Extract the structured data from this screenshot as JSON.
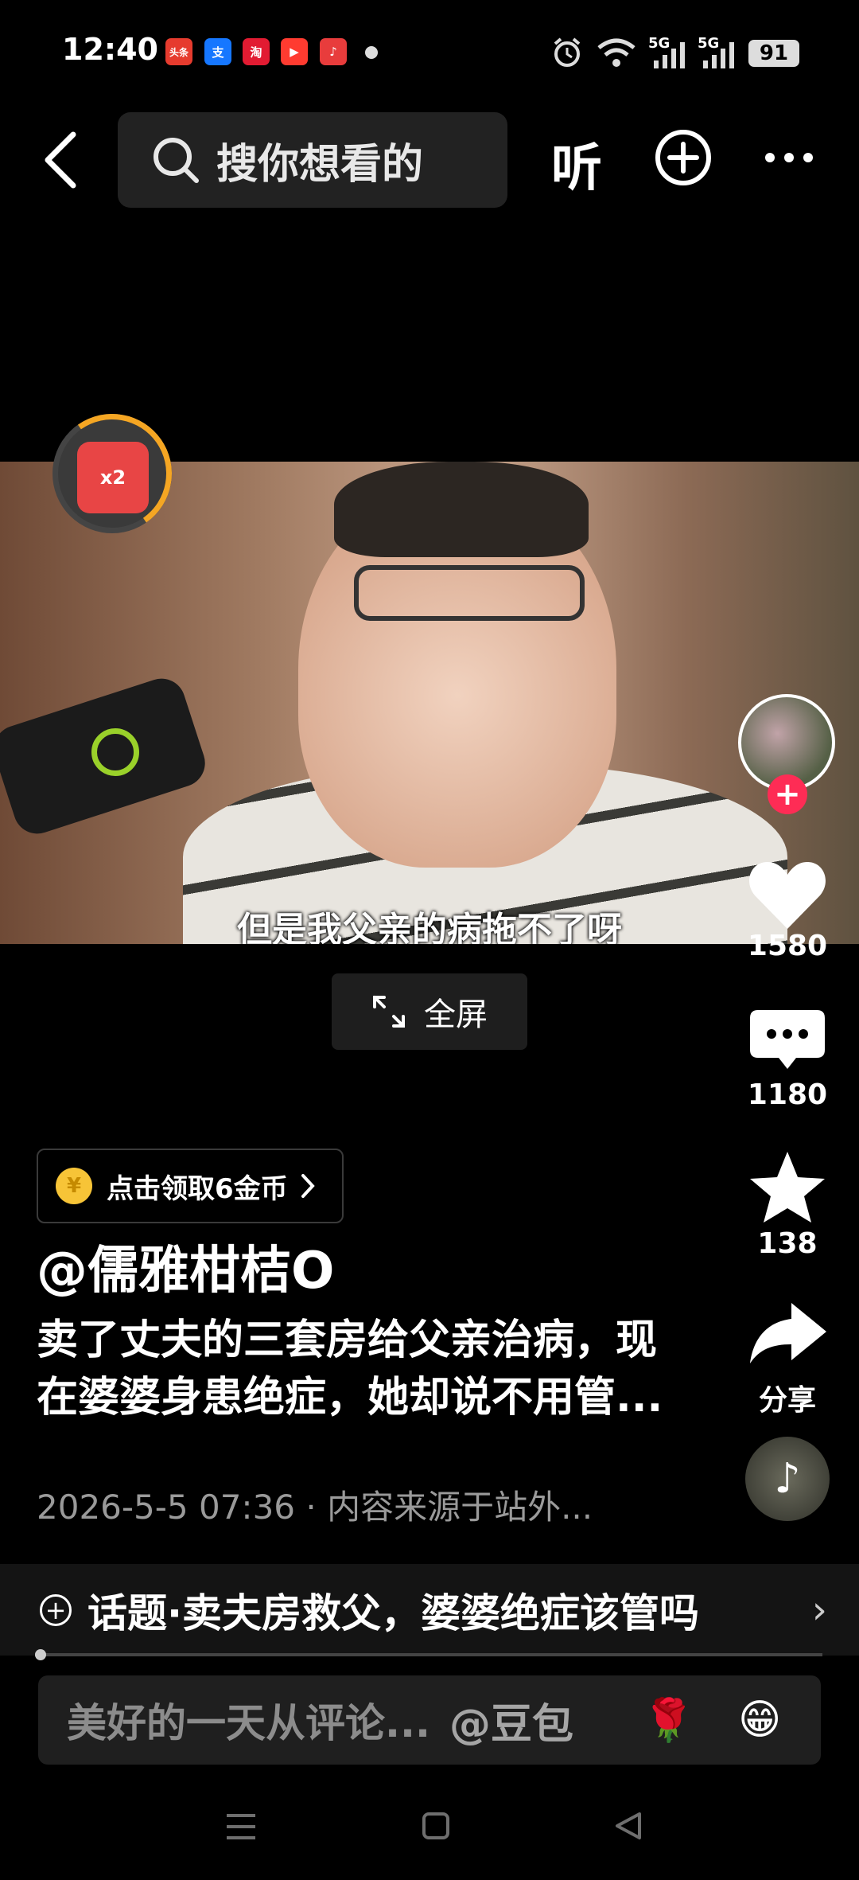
{
  "status_bar": {
    "time": "12:40",
    "app_icons": [
      {
        "name": "toutiao-icon",
        "label": "头条",
        "color": "#e63b2e"
      },
      {
        "name": "alipay-icon",
        "label": "支",
        "color": "#1677ff"
      },
      {
        "name": "taobao-icon",
        "label": "淘",
        "color": "#e21b32"
      },
      {
        "name": "video-app-icon",
        "label": "▶",
        "color": "#ff3b30"
      },
      {
        "name": "douyin-lite-icon",
        "label": "♪",
        "color": "#e83c3c"
      }
    ],
    "network_1": "5G",
    "network_2": "5G",
    "battery": "91"
  },
  "top_bar": {
    "search_placeholder": "搜你想看的",
    "listen_label": "听"
  },
  "video": {
    "subtitle": "但是我父亲的病拖不了呀",
    "red_packet_label": "x2",
    "fullscreen_label": "全屏"
  },
  "right_rail": {
    "likes": "1580",
    "comments": "1180",
    "favorites": "138",
    "share_label": "分享"
  },
  "info": {
    "coin_text": "点击领取6金币",
    "coin_symbol": "¥",
    "author": "@儒雅柑桔O",
    "description": "卖了丈夫的三套房给父亲治病，现在婆婆身患绝症，她却说不用管...",
    "date_source": "2026-5-5 07:36 · 内容来源于站外..."
  },
  "topic": {
    "text": "话题·卖夫房救父，婆婆绝症该管吗"
  },
  "comment_bar": {
    "placeholder": "美好的一天从评论...",
    "mention": "@豆包",
    "emoji_1": "🌹",
    "emoji_2": "😁"
  }
}
